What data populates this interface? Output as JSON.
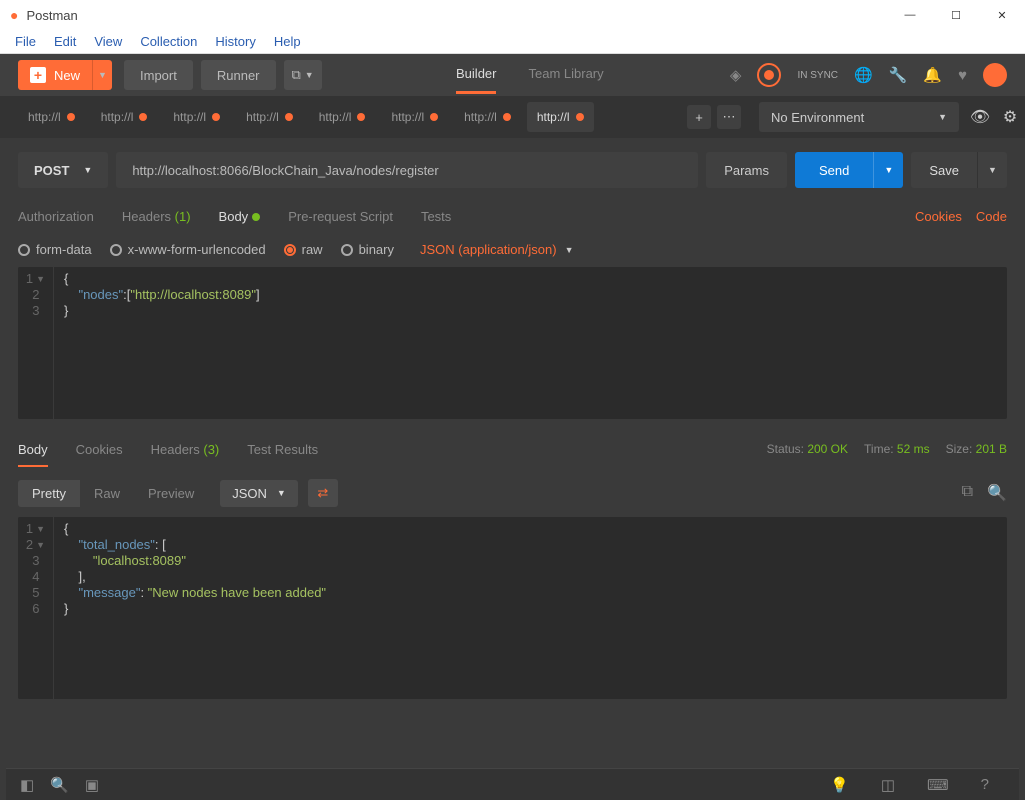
{
  "window": {
    "title": "Postman"
  },
  "menubar": [
    "File",
    "Edit",
    "View",
    "Collection",
    "History",
    "Help"
  ],
  "toolbar": {
    "new_label": "New",
    "import_label": "Import",
    "runner_label": "Runner",
    "center": {
      "builder": "Builder",
      "team": "Team Library"
    },
    "sync_label": "IN SYNC"
  },
  "tabs": [
    {
      "label": "http://l",
      "active": false
    },
    {
      "label": "http://l",
      "active": false
    },
    {
      "label": "http://l",
      "active": false
    },
    {
      "label": "http://l",
      "active": false
    },
    {
      "label": "http://l",
      "active": false
    },
    {
      "label": "http://l",
      "active": false
    },
    {
      "label": "http://l",
      "active": false
    },
    {
      "label": "http://l",
      "active": true
    }
  ],
  "environment": {
    "label": "No Environment"
  },
  "request": {
    "method": "POST",
    "url": "http://localhost:8066/BlockChain_Java/nodes/register",
    "params_label": "Params",
    "send_label": "Send",
    "save_label": "Save"
  },
  "req_tabs": {
    "authorization": "Authorization",
    "headers": "Headers",
    "headers_count": "(1)",
    "body": "Body",
    "prerequest": "Pre-request Script",
    "tests": "Tests",
    "cookies": "Cookies",
    "code": "Code"
  },
  "body_types": {
    "formdata": "form-data",
    "xwww": "x-www-form-urlencoded",
    "raw": "raw",
    "binary": "binary",
    "raw_dropdown": "JSON (application/json)"
  },
  "request_body_lines": [
    {
      "n": "1",
      "fold": true,
      "tokens": [
        {
          "t": "p",
          "v": "{"
        }
      ]
    },
    {
      "n": "2",
      "tokens": [
        {
          "t": "pad",
          "v": "    "
        },
        {
          "t": "k",
          "v": "\"nodes\""
        },
        {
          "t": "p",
          "v": ":["
        },
        {
          "t": "s",
          "v": "\"http://localhost:8089\""
        },
        {
          "t": "p",
          "v": "]"
        }
      ]
    },
    {
      "n": "3",
      "tokens": [
        {
          "t": "p",
          "v": "}"
        }
      ]
    }
  ],
  "response": {
    "tabs": {
      "body": "Body",
      "cookies": "Cookies",
      "headers": "Headers",
      "headers_count": "(3)",
      "tests": "Test Results"
    },
    "status_label": "Status:",
    "status_value": "200 OK",
    "time_label": "Time:",
    "time_value": "52 ms",
    "size_label": "Size:",
    "size_value": "201 B",
    "views": {
      "pretty": "Pretty",
      "raw": "Raw",
      "preview": "Preview"
    },
    "format": "JSON"
  },
  "response_body_lines": [
    {
      "n": "1",
      "fold": true,
      "tokens": [
        {
          "t": "p",
          "v": "{"
        }
      ]
    },
    {
      "n": "2",
      "fold": true,
      "tokens": [
        {
          "t": "pad",
          "v": "    "
        },
        {
          "t": "k",
          "v": "\"total_nodes\""
        },
        {
          "t": "p",
          "v": ": ["
        }
      ]
    },
    {
      "n": "3",
      "tokens": [
        {
          "t": "pad",
          "v": "        "
        },
        {
          "t": "s",
          "v": "\"localhost:8089\""
        }
      ]
    },
    {
      "n": "4",
      "tokens": [
        {
          "t": "pad",
          "v": "    "
        },
        {
          "t": "p",
          "v": "],"
        }
      ]
    },
    {
      "n": "5",
      "tokens": [
        {
          "t": "pad",
          "v": "    "
        },
        {
          "t": "k",
          "v": "\"message\""
        },
        {
          "t": "p",
          "v": ": "
        },
        {
          "t": "s",
          "v": "\"New nodes have been added\""
        }
      ]
    },
    {
      "n": "6",
      "tokens": [
        {
          "t": "p",
          "v": "}"
        }
      ]
    }
  ]
}
